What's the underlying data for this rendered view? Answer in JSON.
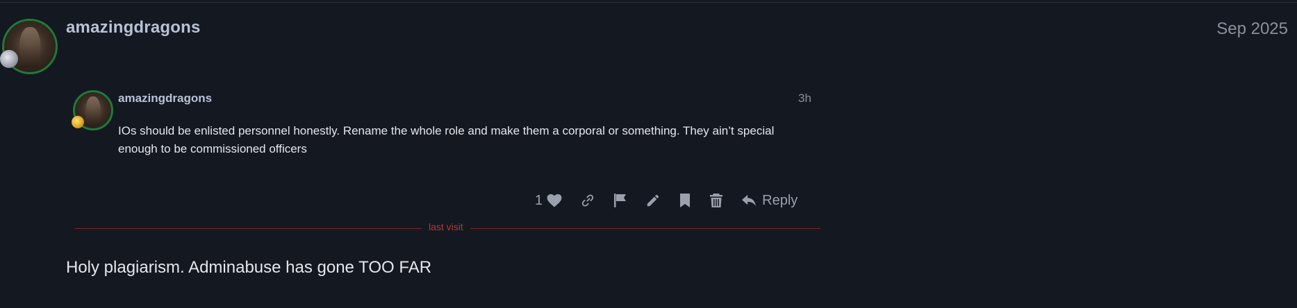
{
  "post": {
    "username": "amazingdragons",
    "date": "Sep 2025",
    "body": "Holy plagiarism. Adminabuse has gone TOO FAR"
  },
  "quoted_post": {
    "username": "amazingdragons",
    "time": "3h",
    "body": "IOs should be enlisted personnel honestly. Rename the whole role and make them a corporal or something. They ain’t special enough to be commissioned officers",
    "like_count": "1",
    "reply_label": "Reply"
  },
  "divider": {
    "label": "last visit"
  },
  "colors": {
    "background": "#141821",
    "username": "#b8c3d6",
    "muted": "#8b919c",
    "text": "#e4e7ec",
    "avatar_ring": "#1e7a3a",
    "last_visit": "#b33a34"
  },
  "icons": {
    "actions": [
      "heart-icon",
      "link-icon",
      "flag-icon",
      "pencil-icon",
      "bookmark-icon",
      "trash-icon",
      "reply-icon"
    ]
  }
}
